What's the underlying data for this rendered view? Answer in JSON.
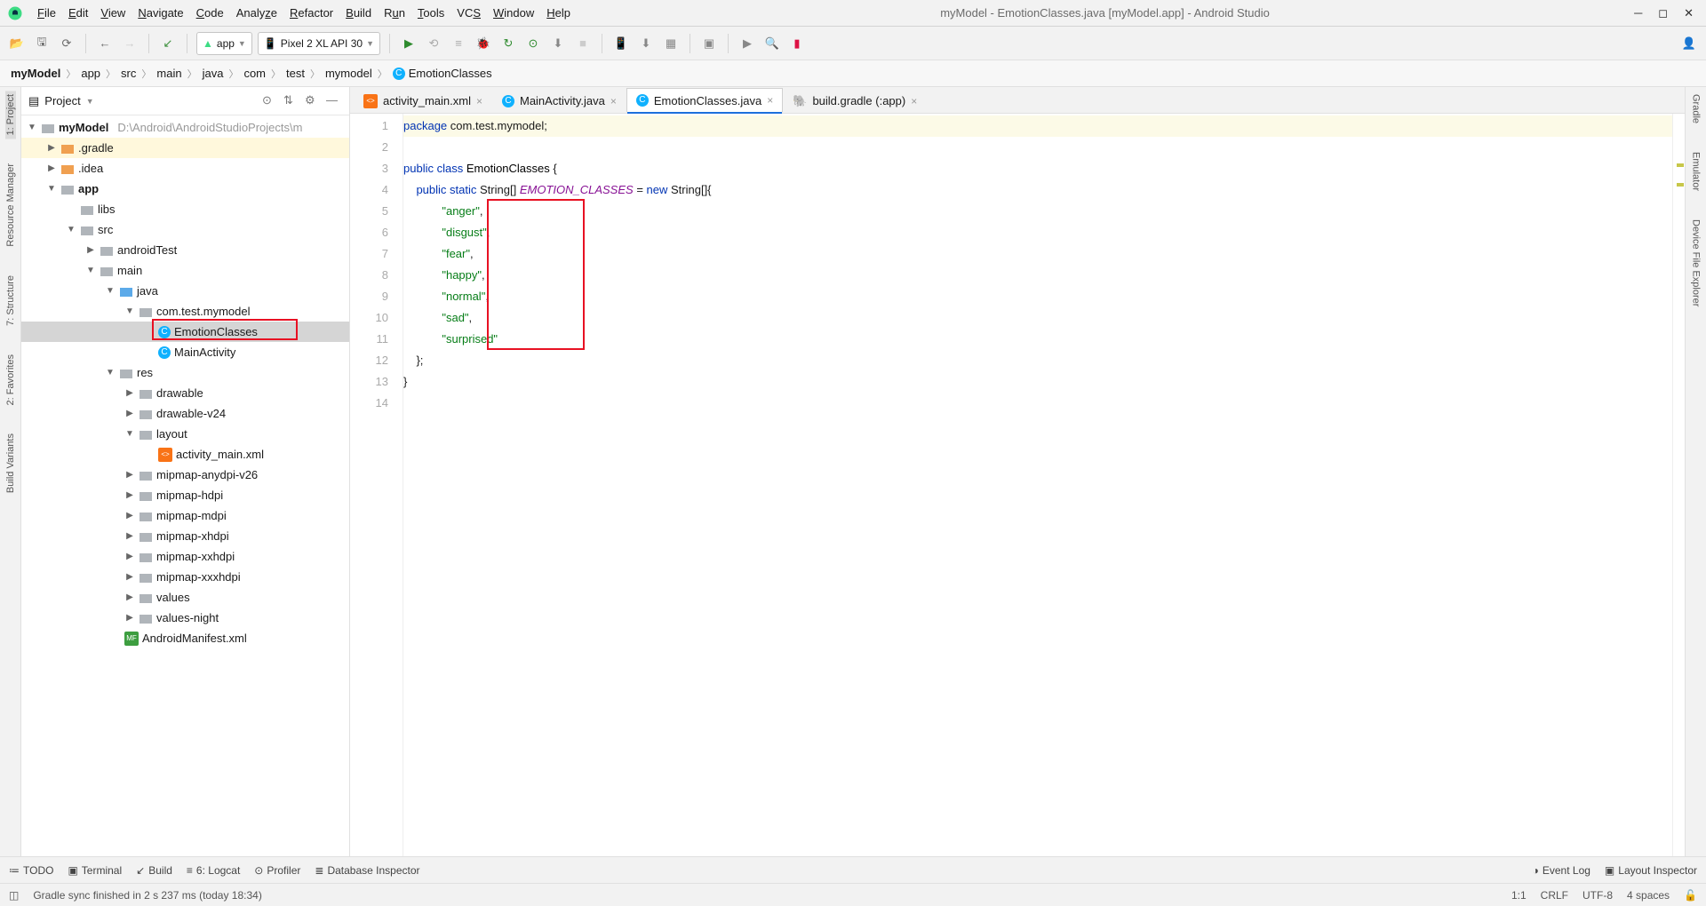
{
  "window": {
    "title": "myModel - EmotionClasses.java [myModel.app] - Android Studio"
  },
  "menu": [
    "File",
    "Edit",
    "View",
    "Navigate",
    "Code",
    "Analyze",
    "Refactor",
    "Build",
    "Run",
    "Tools",
    "VCS",
    "Window",
    "Help"
  ],
  "toolbar": {
    "config": "app",
    "device": "Pixel 2 XL API 30"
  },
  "breadcrumb": [
    "myModel",
    "app",
    "src",
    "main",
    "java",
    "com",
    "test",
    "mymodel",
    "EmotionClasses"
  ],
  "panel": {
    "title": "Project",
    "root": "myModel",
    "rootPath": "D:\\Android\\AndroidStudioProjects\\m",
    "tree": {
      "gradle": ".gradle",
      "idea": ".idea",
      "app": "app",
      "libs": "libs",
      "src": "src",
      "androidTest": "androidTest",
      "main": "main",
      "java": "java",
      "pkg": "com.test.mymodel",
      "emotionClasses": "EmotionClasses",
      "mainActivity": "MainActivity",
      "res": "res",
      "drawable": "drawable",
      "drawableV24": "drawable-v24",
      "layout": "layout",
      "activityMain": "activity_main.xml",
      "mipmapAnydpi": "mipmap-anydpi-v26",
      "mipmapHdpi": "mipmap-hdpi",
      "mipmapMdpi": "mipmap-mdpi",
      "mipmapXhdpi": "mipmap-xhdpi",
      "mipmapXxhdpi": "mipmap-xxhdpi",
      "mipmapXxxhdpi": "mipmap-xxxhdpi",
      "values": "values",
      "valuesNight": "values-night",
      "manifest": "AndroidManifest.xml"
    }
  },
  "tabs": [
    {
      "label": "activity_main.xml",
      "icon": "xml"
    },
    {
      "label": "MainActivity.java",
      "icon": "class"
    },
    {
      "label": "EmotionClasses.java",
      "icon": "class",
      "active": true
    },
    {
      "label": "build.gradle (:app)",
      "icon": "gradle"
    }
  ],
  "code": {
    "package": "package",
    "pkgName": "com.test.mymodel",
    "public": "public",
    "class": "class",
    "className": "EmotionClasses",
    "static": "static",
    "stringArr": "String[]",
    "field": "EMOTION_CLASSES",
    "newKw": "new",
    "values": [
      "\"anger\"",
      "\"disgust\"",
      "\"fear\"",
      "\"happy\"",
      "\"normal\"",
      "\"sad\"",
      "\"surprised\""
    ]
  },
  "leftTools": [
    "1: Project",
    "Resource Manager",
    "7: Structure",
    "2: Favorites",
    "Build Variants"
  ],
  "rightTools": [
    "Gradle",
    "Emulator",
    "Device File Explorer"
  ],
  "bottom": {
    "todo": "TODO",
    "terminal": "Terminal",
    "build": "Build",
    "logcat": "6: Logcat",
    "profiler": "Profiler",
    "dbInspector": "Database Inspector",
    "eventLog": "Event Log",
    "layoutInspector": "Layout Inspector"
  },
  "status": {
    "msg": "Gradle sync finished in 2 s 237 ms (today 18:34)",
    "pos": "1:1",
    "eol": "CRLF",
    "enc": "UTF-8",
    "indent": "4 spaces"
  }
}
